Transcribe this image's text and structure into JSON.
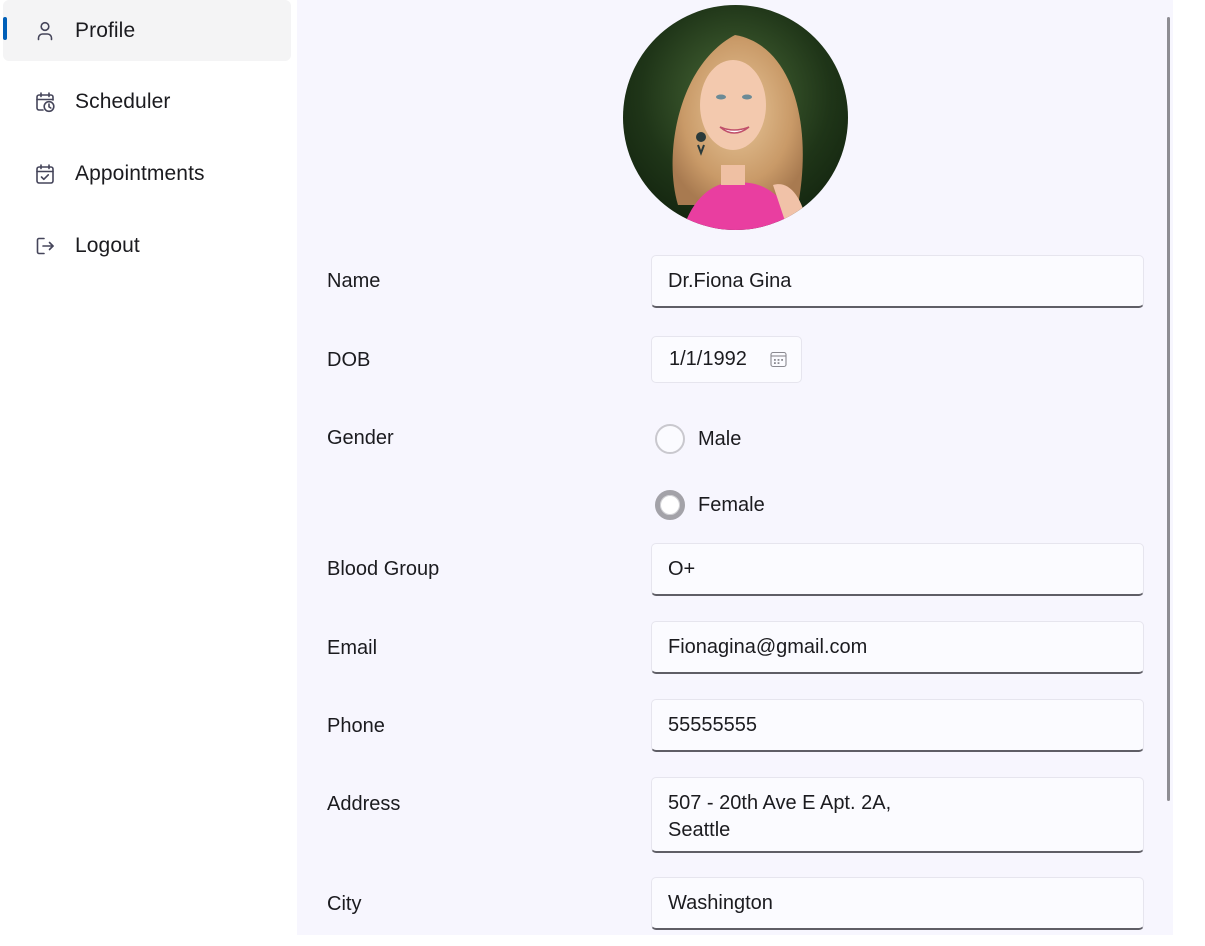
{
  "sidebar": {
    "items": [
      {
        "label": "Profile",
        "icon": "person-icon",
        "selected": true
      },
      {
        "label": "Scheduler",
        "icon": "calendar-clock-icon",
        "selected": false
      },
      {
        "label": "Appointments",
        "icon": "calendar-check-icon",
        "selected": false
      },
      {
        "label": "Logout",
        "icon": "sign-out-icon",
        "selected": false
      }
    ],
    "accent_color": "#005fb8"
  },
  "profile": {
    "avatar_alt": "Profile photo of Dr.Fiona Gina",
    "fields": {
      "name": {
        "label": "Name",
        "value": "Dr.Fiona Gina"
      },
      "dob": {
        "label": "DOB",
        "value": "1/1/1992"
      },
      "gender": {
        "label": "Gender",
        "options": [
          "Male",
          "Female"
        ],
        "selected": "Female"
      },
      "blood_group": {
        "label": "Blood Group",
        "value": "O+"
      },
      "email": {
        "label": "Email",
        "value": "Fionagina@gmail.com"
      },
      "phone": {
        "label": "Phone",
        "value": "55555555"
      },
      "address": {
        "label": "Address",
        "line1": "507 - 20th Ave E Apt. 2A,",
        "line2": "Seattle"
      },
      "city": {
        "label": "City",
        "value": "Washington"
      }
    }
  }
}
